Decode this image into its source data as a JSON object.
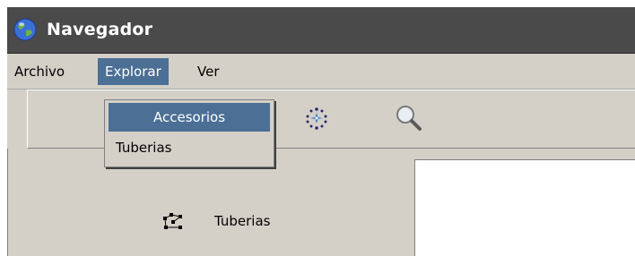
{
  "window": {
    "title": "Navegador",
    "icon": "globe-icon"
  },
  "menubar": {
    "items": [
      {
        "label": "Archivo"
      },
      {
        "label": "Explorar",
        "active": true
      },
      {
        "label": "Ver"
      }
    ]
  },
  "dropdown": {
    "items": [
      {
        "label": "Accesorios",
        "highlighted": true
      },
      {
        "label": "Tuberias"
      }
    ]
  },
  "toolbar": {
    "icons": [
      "network-sparkle-icon",
      "magnifier-icon"
    ]
  },
  "tree": {
    "items": [
      {
        "label": "Tuberias",
        "icon": "pipe-network-icon"
      }
    ]
  },
  "colors": {
    "titlebar": "#4a4a4a",
    "highlight": "#4c6f95",
    "chrome": "#d4d0c8"
  }
}
